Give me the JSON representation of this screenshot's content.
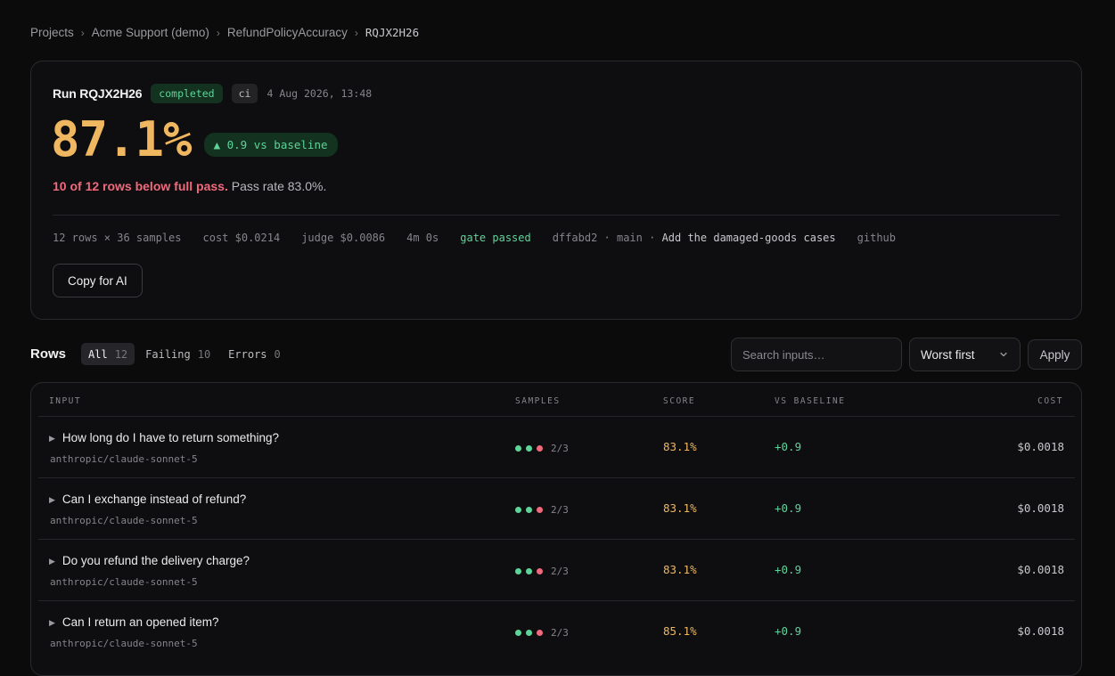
{
  "breadcrumb": {
    "items": [
      "Projects",
      "Acme Support (demo)",
      "RefundPolicyAccuracy"
    ],
    "current": "RQJX2H26",
    "separator": "›"
  },
  "run": {
    "title": "Run RQJX2H26",
    "status": "completed",
    "env": "ci",
    "date": "4 Aug 2026, 13:48",
    "score": "87.1%",
    "delta": "▲ 0.9 vs baseline",
    "summary_warn": "10 of 12 rows below full pass.",
    "summary_rest": "Pass rate 83.0%.",
    "meta": {
      "rows_samples": "12 rows × 36 samples",
      "cost": "cost $0.0214",
      "judge": "judge $0.0086",
      "duration": "4m 0s",
      "gate": "gate passed",
      "commit_prefix": "dffabd2 · main · ",
      "commit_msg": "Add the damaged-goods cases",
      "source": "github"
    },
    "copy_label": "Copy for AI"
  },
  "rows_section": {
    "label": "Rows",
    "filters": [
      {
        "label": "All",
        "count": "12"
      },
      {
        "label": "Failing",
        "count": "10"
      },
      {
        "label": "Errors",
        "count": "0"
      }
    ],
    "search_placeholder": "Search inputs…",
    "sort_value": "Worst first",
    "apply_label": "Apply"
  },
  "table": {
    "headers": {
      "input": "INPUT",
      "samples": "SAMPLES",
      "score": "SCORE",
      "vs": "VS BASELINE",
      "cost": "COST"
    },
    "rows": [
      {
        "question": "How long do I have to return something?",
        "model": "anthropic/claude-sonnet-5",
        "samples": [
          "pass",
          "pass",
          "fail"
        ],
        "frac": "2/3",
        "score": "83.1%",
        "vs": "+0.9",
        "cost": "$0.0018"
      },
      {
        "question": "Can I exchange instead of refund?",
        "model": "anthropic/claude-sonnet-5",
        "samples": [
          "pass",
          "pass",
          "fail"
        ],
        "frac": "2/3",
        "score": "83.1%",
        "vs": "+0.9",
        "cost": "$0.0018"
      },
      {
        "question": "Do you refund the delivery charge?",
        "model": "anthropic/claude-sonnet-5",
        "samples": [
          "pass",
          "pass",
          "fail"
        ],
        "frac": "2/3",
        "score": "83.1%",
        "vs": "+0.9",
        "cost": "$0.0018"
      },
      {
        "question": "Can I return an opened item?",
        "model": "anthropic/claude-sonnet-5",
        "samples": [
          "pass",
          "pass",
          "fail"
        ],
        "frac": "2/3",
        "score": "85.1%",
        "vs": "+0.9",
        "cost": "$0.0018"
      }
    ]
  },
  "colors": {
    "accent_score": "#efb760",
    "pass": "#5fd49a",
    "fail": "#f06a7d",
    "background": "#0b0b0c"
  }
}
